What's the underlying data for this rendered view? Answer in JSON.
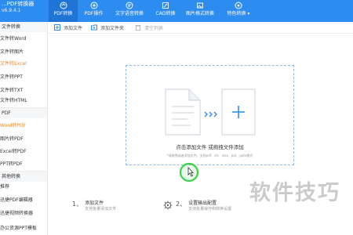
{
  "app": {
    "title": "...PDF转换器",
    "version": "v6.9.4.1"
  },
  "nav": {
    "tabs": [
      {
        "label": "PDF转换",
        "icon": "pdf-convert-icon",
        "active": true
      },
      {
        "label": "PDF操作",
        "icon": "pdf-operate-icon",
        "active": false
      },
      {
        "label": "文字语音转换",
        "icon": "text-speech-icon",
        "active": false
      },
      {
        "label": "CAD转换",
        "icon": "cad-convert-icon",
        "active": false
      },
      {
        "label": "图片格式转换",
        "icon": "image-convert-icon",
        "active": false
      },
      {
        "label": "特色转换 ▾",
        "icon": "special-convert-icon",
        "active": false
      }
    ]
  },
  "sidebar": {
    "section1": "文件转换",
    "items1": [
      "文件转Word",
      "文件转图片",
      "文件转Excel",
      "文件转PPT",
      "文件转TXT",
      "文件转HTML"
    ],
    "section2": "PDF",
    "items2": [
      "Word转PDF",
      "图片转PDF",
      "Excel转PDF",
      "PPT转PDF"
    ],
    "section3": "其他转换",
    "items3": [
      "推荐",
      "迅捷PDF编辑器",
      "迅捷视频转换器",
      "办公资源PPT模板"
    ]
  },
  "toolbar": {
    "add_file": "添加文件",
    "add_folder": "添加文件夹",
    "clear_list": "清空列表"
  },
  "dropzone": {
    "title": "点击添加文件 或拖拽文件添加",
    "subtitle": "*请拖拽或者添加文件，支持pdf、xls、xlsx、ppt、pptx格式"
  },
  "steps": [
    {
      "num": "1、",
      "title": "添加文件",
      "desc": "支持批量添加文件"
    },
    {
      "num": "2、",
      "title": "设置输出配置",
      "desc": "支持批量操作和转换设置"
    }
  ],
  "watermark": "软件技巧",
  "colors": {
    "brand": "#2d8cf0",
    "active_tab": "#1f74d6",
    "highlight": "#f08a24",
    "cursor_ring": "#3cd14a"
  }
}
